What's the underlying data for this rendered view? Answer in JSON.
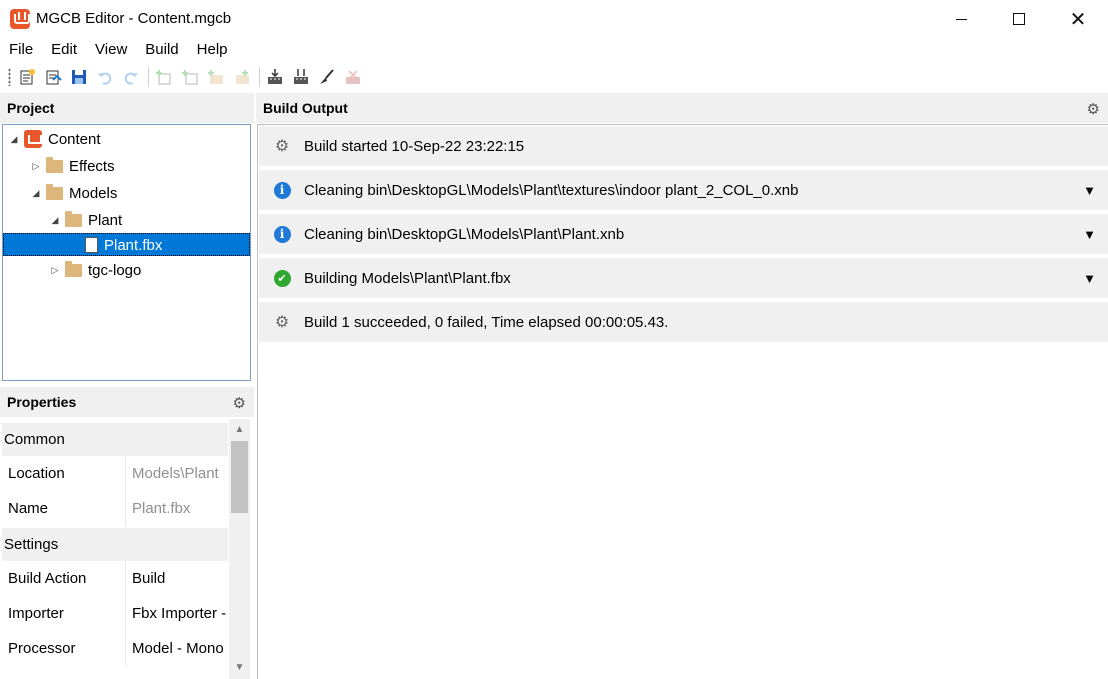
{
  "window": {
    "title": "MGCB Editor - Content.mgcb"
  },
  "menu": [
    "File",
    "Edit",
    "View",
    "Build",
    "Help"
  ],
  "toolbar": {
    "icons": [
      "new-project",
      "open-project",
      "save",
      "undo",
      "redo",
      "new-item",
      "add-existing-item",
      "new-folder",
      "add-existing-folder",
      "build",
      "rebuild",
      "clean",
      "cancel-build"
    ]
  },
  "project": {
    "header": "Project",
    "tree": [
      {
        "label": "Content",
        "depth": 0,
        "expanded": true,
        "type": "root"
      },
      {
        "label": "Effects",
        "depth": 1,
        "expanded": false,
        "type": "folder"
      },
      {
        "label": "Models",
        "depth": 1,
        "expanded": true,
        "type": "folder"
      },
      {
        "label": "Plant",
        "depth": 2,
        "expanded": true,
        "type": "folder"
      },
      {
        "label": "Plant.fbx",
        "depth": 3,
        "type": "file",
        "selected": true
      },
      {
        "label": "tgc-logo",
        "depth": 2,
        "expanded": false,
        "type": "folder"
      }
    ]
  },
  "properties": {
    "header": "Properties",
    "common_label": "Common",
    "settings_label": "Settings",
    "location": {
      "name": "Location",
      "value": "Models\\Plant"
    },
    "name": {
      "name": "Name",
      "value": "Plant.fbx"
    },
    "build_action": {
      "name": "Build Action",
      "value": "Build"
    },
    "importer": {
      "name": "Importer",
      "value": "Fbx Importer -"
    },
    "processor": {
      "name": "Processor",
      "value": "Model - Mono"
    }
  },
  "build_output": {
    "header": "Build Output",
    "entries": [
      {
        "icon": "gears",
        "text": "Build started 10-Sep-22 23:22:15",
        "expandable": false
      },
      {
        "icon": "info",
        "text": "Cleaning bin\\DesktopGL\\Models\\Plant\\textures\\indoor plant_2_COL_0.xnb",
        "expandable": true
      },
      {
        "icon": "info",
        "text": "Cleaning bin\\DesktopGL\\Models\\Plant\\Plant.xnb",
        "expandable": true
      },
      {
        "icon": "success",
        "text": "Building Models\\Plant\\Plant.fbx",
        "expandable": true
      },
      {
        "icon": "gears-success",
        "text": "Build 1 succeeded, 0 failed, Time elapsed 00:00:05.43.",
        "expandable": false
      }
    ]
  },
  "colors": {
    "accent": "#0078d7",
    "brand": "#e8562a",
    "info": "#1e7ad6",
    "success": "#2fa82f",
    "panel": "#f0f0f0"
  }
}
